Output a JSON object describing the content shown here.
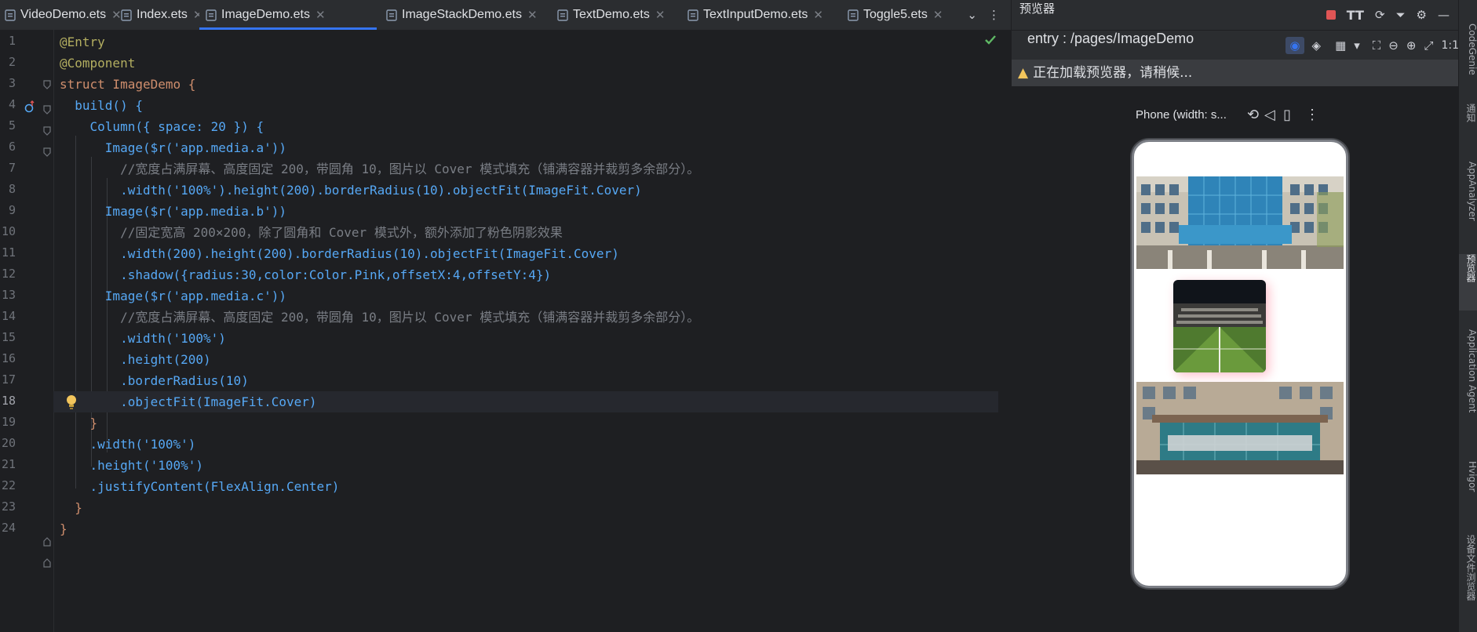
{
  "tabs": [
    {
      "label": "VideoDemo.ets",
      "active": false
    },
    {
      "label": "Index.ets",
      "active": false
    },
    {
      "label": "ImageDemo.ets",
      "active": true
    },
    {
      "label": "ImageStackDemo.ets",
      "active": false
    },
    {
      "label": "TextDemo.ets",
      "active": false
    },
    {
      "label": "TextInputDemo.ets",
      "active": false
    },
    {
      "label": "Toggle5.ets",
      "active": false
    }
  ],
  "editor": {
    "line_numbers": [
      "1",
      "2",
      "3",
      "4",
      "5",
      "6",
      "7",
      "8",
      "9",
      "10",
      "11",
      "12",
      "13",
      "14",
      "15",
      "16",
      "17",
      "18",
      "19",
      "20",
      "21",
      "22",
      "23",
      "24"
    ],
    "current_line": "18",
    "code": [
      "@Entry",
      "@Component",
      "struct ImageDemo {",
      "  build() {",
      "    Column({ space: 20 }) {",
      "      Image($r('app.media.a'))",
      "        //宽度占满屏幕、高度固定 200，带圆角 10，图片以 Cover 模式填充（铺满容器并裁剪多余部分）。",
      "        .width('100%').height(200).borderRadius(10).objectFit(ImageFit.Cover)",
      "      Image($r('app.media.b'))",
      "        //固定宽高 200×200，除了圆角和 Cover 模式外，额外添加了粉色阴影效果",
      "        .width(200).height(200).borderRadius(10).objectFit(ImageFit.Cover)",
      "        .shadow({radius:30,color:Color.Pink,offsetX:4,offsetY:4})",
      "      Image($r('app.media.c'))",
      "        //宽度占满屏幕、高度固定 200，带圆角 10，图片以 Cover 模式填充（铺满容器并裁剪多余部分）。",
      "        .width('100%')",
      "        .height(200)",
      "        .borderRadius(10)",
      "        .objectFit(ImageFit.Cover)",
      "    }",
      "    .width('100%')",
      "    .height('100%')",
      "    .justifyContent(FlexAlign.Center)",
      "  }",
      "}"
    ]
  },
  "previewer": {
    "title": "预览器",
    "entry": "entry : /pages/ImageDemo",
    "warning": "正在加载预览器，请稍候...",
    "device_label": "Phone (width: s...",
    "zoom_label": "1:1"
  },
  "right_strip": [
    "CodeGenie",
    "通知",
    "AppAnalyzer",
    "预览器",
    "Application Agent",
    "Hvigor",
    "设备文件浏览器"
  ],
  "colors": {
    "accent": "#3574f0",
    "warning": "#f2c55c",
    "stop": "#e05555"
  }
}
